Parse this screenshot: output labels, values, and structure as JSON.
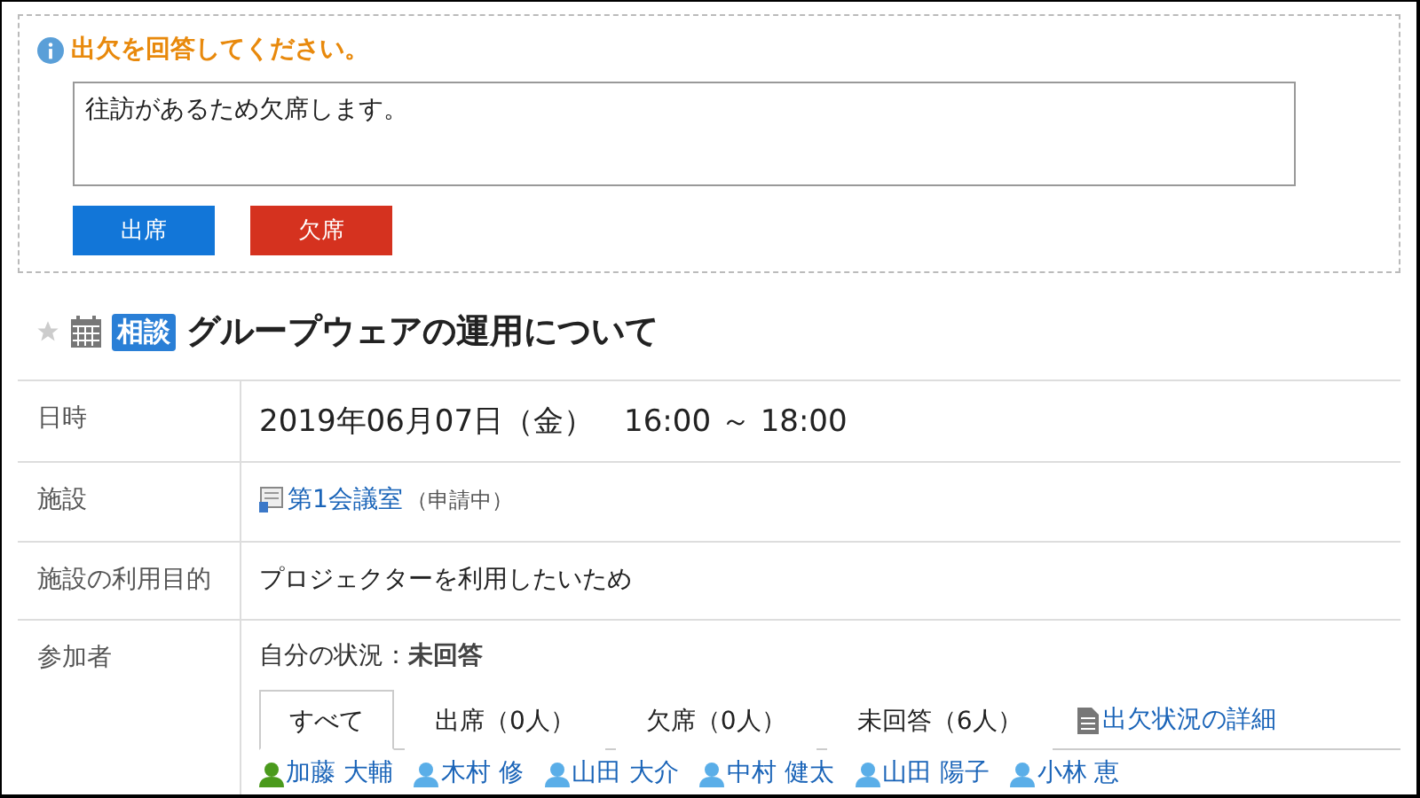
{
  "notice": {
    "message": "出欠を回答してください。",
    "comment": "往訪があるため欠席します。",
    "buttons": [
      {
        "label": "出席",
        "kind": "attend"
      },
      {
        "label": "欠席",
        "kind": "absent"
      }
    ]
  },
  "event": {
    "starred": false,
    "tag": "相談",
    "title": "グループウェアの運用について"
  },
  "details": [
    {
      "kind": "datetime",
      "label": "日時",
      "value": "2019年06月07日（金）　16:00 ～ 18:00"
    },
    {
      "kind": "facility",
      "label": "施設",
      "link": "第1会議室",
      "note": "（申請中）"
    },
    {
      "kind": "text",
      "label": "施設の利用目的",
      "value": "プロジェクターを利用したいため"
    },
    {
      "kind": "participants",
      "label": "参加者",
      "status_label": "自分の状況：",
      "status": "未回答",
      "tabs": [
        {
          "label": "すべて",
          "selected": true
        },
        {
          "label": "出席（0人）",
          "selected": false
        },
        {
          "label": "欠席（0人）",
          "selected": false
        },
        {
          "label": "未回答（6人）",
          "selected": false
        }
      ],
      "detail_link": "出欠状況の詳細",
      "people": [
        {
          "name": "加藤 大輔",
          "color": "#4a9a1c"
        },
        {
          "name": "木村 修",
          "color": "#5aaee8"
        },
        {
          "name": "山田 大介",
          "color": "#5aaee8"
        },
        {
          "name": "中村 健太",
          "color": "#5aaee8"
        },
        {
          "name": "山田 陽子",
          "color": "#5aaee8"
        },
        {
          "name": "小林 恵",
          "color": "#5aaee8"
        }
      ]
    }
  ]
}
